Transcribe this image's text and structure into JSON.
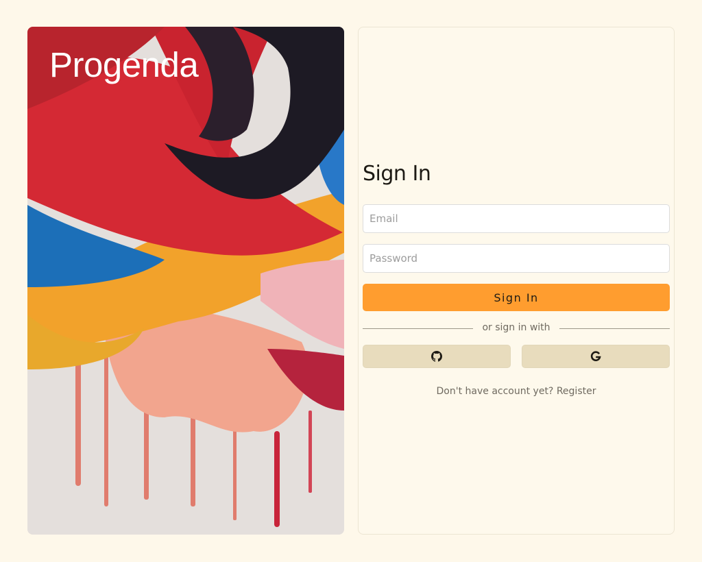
{
  "brand": {
    "name": "Progenda"
  },
  "signin": {
    "title": "Sign In",
    "email_placeholder": "Email",
    "password_placeholder": "Password",
    "submit_label": "Sign In",
    "divider_text": "or sign in with",
    "social": [
      {
        "name": "github",
        "icon": "github-icon"
      },
      {
        "name": "google",
        "icon": "google-icon"
      }
    ],
    "register_prompt": "Don't have account yet?",
    "register_link": "Register"
  },
  "colors": {
    "background": "#fef8ea",
    "primary": "#ff9d2f",
    "social_button": "#e8dcbd"
  }
}
